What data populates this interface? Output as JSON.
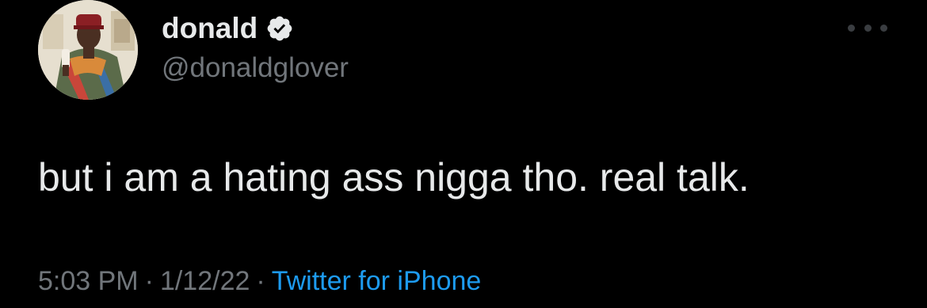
{
  "author": {
    "display_name": "donald",
    "handle": "@donaldglover",
    "verified": true
  },
  "tweet": {
    "text": "but i am a hating ass nigga tho. real talk.",
    "time": "5:03 PM",
    "date": "1/12/22",
    "separator": "·",
    "source": "Twitter for iPhone"
  },
  "icons": {
    "verified": "verified-badge-icon",
    "more": "more-options-icon"
  },
  "colors": {
    "background": "#000000",
    "primary_text": "#e7e9ea",
    "secondary_text": "#71767b",
    "link": "#1d9bf0"
  }
}
